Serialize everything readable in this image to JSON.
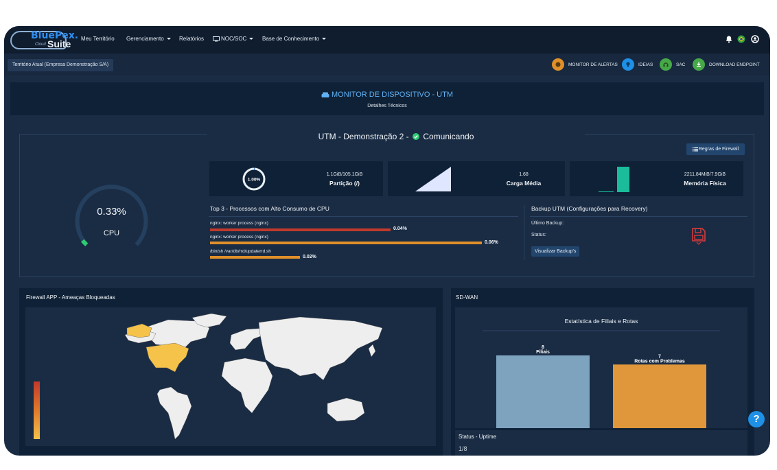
{
  "brand": {
    "name": "BluePex",
    "dot": ".",
    "cloud": "Cloud",
    "suite": "Suite"
  },
  "nav": {
    "items": [
      {
        "label": "Meu Território"
      },
      {
        "label": "Gerenciamento"
      },
      {
        "label": "Relatórios"
      },
      {
        "label": "NOC/SOC"
      },
      {
        "label": "Base de Conhecimento"
      }
    ]
  },
  "territory": "Território Atual (Empresa Demonstração S/A)",
  "quicklinks": [
    {
      "label": "MONITOR DE ALERTAS",
      "color": "#e0902a"
    },
    {
      "label": "IDEIAS",
      "color": "#1e90e6"
    },
    {
      "label": "SAC",
      "color": "#47a847"
    },
    {
      "label": "DOWNLOAD ENDPOINT",
      "color": "#47a847"
    }
  ],
  "monitor": {
    "title": "MONITOR DE DISPOSITIVO - UTM",
    "subtitle": "Detalhes Técnicos"
  },
  "device": {
    "name": "UTM - Demonstração 2 -",
    "status": "Comunicando",
    "firewall_button": "Regras de Firewall"
  },
  "stats": {
    "partition": {
      "percent": "1.00%",
      "value": "1.1GiB/105.1GiB",
      "label": "Partição (/)",
      "fraction": 0.01
    },
    "load": {
      "value": "1.68",
      "label": "Carga Média"
    },
    "memory": {
      "value": "2211.84MiB/7.9GiB",
      "label": "Memória Física"
    }
  },
  "cpu": {
    "value": "0.33%",
    "label": "CPU",
    "fraction": 0.0033
  },
  "processes": {
    "title": "Top 3 - Processos com Alto Consumo de CPU",
    "items": [
      {
        "name": "nginx: worker process (nginx)",
        "value": "0.04%",
        "color": "#c0392b"
      },
      {
        "name": "nginx: worker process (nginx)",
        "value": "0.06%",
        "color": "#e0902a"
      },
      {
        "name": "/bin/sh /var/db/rrd/updaterrd.sh",
        "value": "0.02%",
        "color": "#e0902a"
      }
    ]
  },
  "backup": {
    "title": "Backup UTM (Configurações para Recovery)",
    "last": "Último Backup:",
    "status": "Status:",
    "button": "Visualizar Backup's"
  },
  "firewall": {
    "title": "Firewall APP - Ameaças Bloqueadas"
  },
  "sdwan": {
    "title": "SD-WAN",
    "chart_title": "Estatística de Filiais e Rotas",
    "uptime_title": "Status - Uptime",
    "uptime_value": "1/8"
  },
  "chart_data": {
    "type": "bar",
    "title": "Estatística de Filiais e Rotas",
    "categories": [
      "Filiais",
      "Rotas com Problemas"
    ],
    "values": [
      8,
      7
    ],
    "colors": [
      "#7ea3bf",
      "#e0963a"
    ],
    "data_labels": [
      "8",
      "7"
    ]
  }
}
